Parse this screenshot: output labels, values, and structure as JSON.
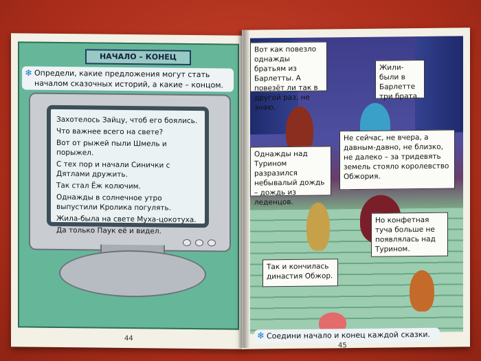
{
  "left_page": {
    "title": "НАЧАЛО – КОНЕЦ",
    "task": "Определи, какие предложения могут стать началом сказочных историй, а какие – концом.",
    "screen_lines": [
      "Захотелось Зайцу, чтоб его боялись.",
      "Что важнее всего на свете?",
      "Вот от рыжей пыли Шмель и порыжел.",
      "С тех пор и начали Синички с Дятлами дружить.",
      "Так стал Ёж колючим.",
      "Однажды в солнечное утро выпустили Кролика погулять.",
      "Жила-была на свете Муха-цокотуха.",
      "Да только Паук её и видел."
    ],
    "page_number": "44"
  },
  "right_page": {
    "bubbles": [
      "Вот как повезло однажды братьям из Барлетты. А повезёт ли так в другой раз, не знаю.",
      "Жили-были в Барлетте три брата.",
      "Не сейчас, не вчера, а давным-давно, не близко, не далеко – за тридевять земель стояло королевство Обжория.",
      "Однажды над Турином разразился небывалый дождь – дождь из леденцов.",
      "Но конфетная туча больше не появлялась над Турином.",
      "Так и кончилась династия Обжор."
    ],
    "task": "Соедини начало и конец каждой сказки.",
    "page_number": "45"
  },
  "colors": {
    "background": "#b3331f",
    "monitor_frame": "#c9cdd2",
    "page_green": "#66b79a",
    "accent_blue": "#1b7bd1"
  }
}
